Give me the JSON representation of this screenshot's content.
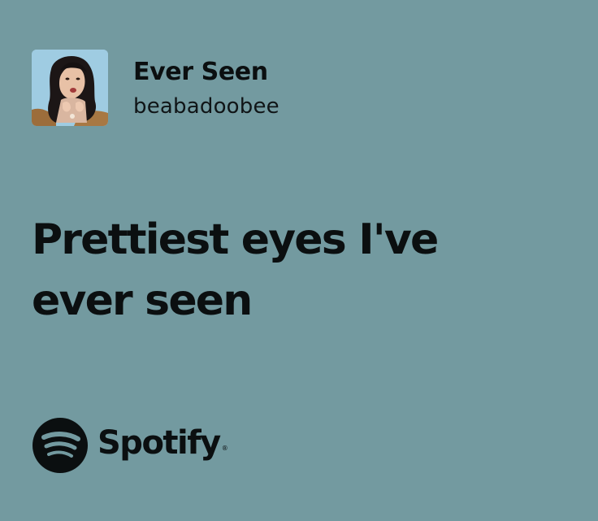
{
  "track": {
    "title": "Ever Seen",
    "artist": "beabadoobee",
    "cover_icon": "album-cover-art"
  },
  "lyrics": {
    "lines": [
      "Prettiest eyes I've",
      "ever seen"
    ]
  },
  "branding": {
    "logo_icon": "spotify-logo-icon",
    "name": "Spotify",
    "trademark": "®"
  },
  "colors": {
    "background": "#739aa0",
    "text": "#0b0f10"
  }
}
